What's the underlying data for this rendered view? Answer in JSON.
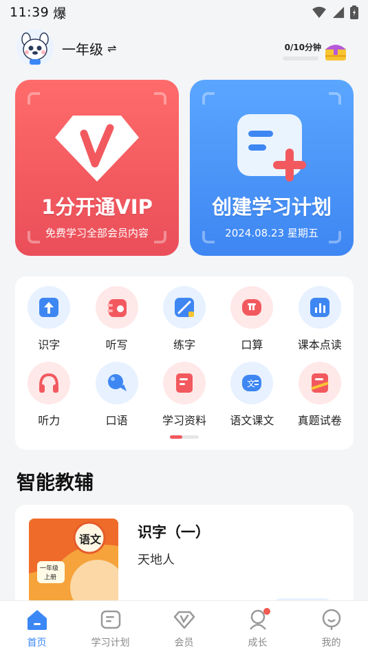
{
  "status": {
    "time": "11:39",
    "extra_glyph": "爆"
  },
  "header": {
    "grade": "一年级",
    "swap_glyph": "⇌",
    "timer": "0/10分钟"
  },
  "cards": [
    {
      "title": "1分开通VIP",
      "subtitle": "免费学习全部会员内容"
    },
    {
      "title": "创建学习计划",
      "subtitle": "2024.08.23 星期五"
    }
  ],
  "grid": [
    {
      "label": "识字",
      "icon": "character-icon",
      "bg": "#e7f1ff"
    },
    {
      "label": "听写",
      "icon": "dictation-icon",
      "bg": "#ffe8e8"
    },
    {
      "label": "练字",
      "icon": "writing-icon",
      "bg": "#e7f1ff"
    },
    {
      "label": "口算",
      "icon": "calc-icon",
      "bg": "#ffe8e8"
    },
    {
      "label": "课本点读",
      "icon": "textbook-icon",
      "bg": "#e7f1ff"
    },
    {
      "label": "听力",
      "icon": "headphones-icon",
      "bg": "#ffe8e8"
    },
    {
      "label": "口语",
      "icon": "speaking-icon",
      "bg": "#e7f1ff"
    },
    {
      "label": "学习资料",
      "icon": "materials-icon",
      "bg": "#ffe8e8"
    },
    {
      "label": "语文课文",
      "icon": "chinese-text-icon",
      "bg": "#e7f1ff"
    },
    {
      "label": "真题试卷",
      "icon": "exam-paper-icon",
      "bg": "#ffe8e8"
    }
  ],
  "section": {
    "title": "智能教辅"
  },
  "tutor": {
    "title": "识字（一）",
    "subtitle": "天地人",
    "cover_subject": "语文",
    "cover_grade": "一年级",
    "cover_volume": "上册"
  },
  "tabs": [
    {
      "label": "首页",
      "icon": "home-icon",
      "active": true
    },
    {
      "label": "学习计划",
      "icon": "plan-icon",
      "active": false
    },
    {
      "label": "会员",
      "icon": "vip-icon",
      "active": false
    },
    {
      "label": "成长",
      "icon": "growth-icon",
      "active": false
    },
    {
      "label": "我的",
      "icon": "profile-icon",
      "active": false
    }
  ],
  "colors": {
    "accent": "#3b87f5",
    "vip_red": "#f2595f",
    "plan_blue": "#3e86f2"
  }
}
